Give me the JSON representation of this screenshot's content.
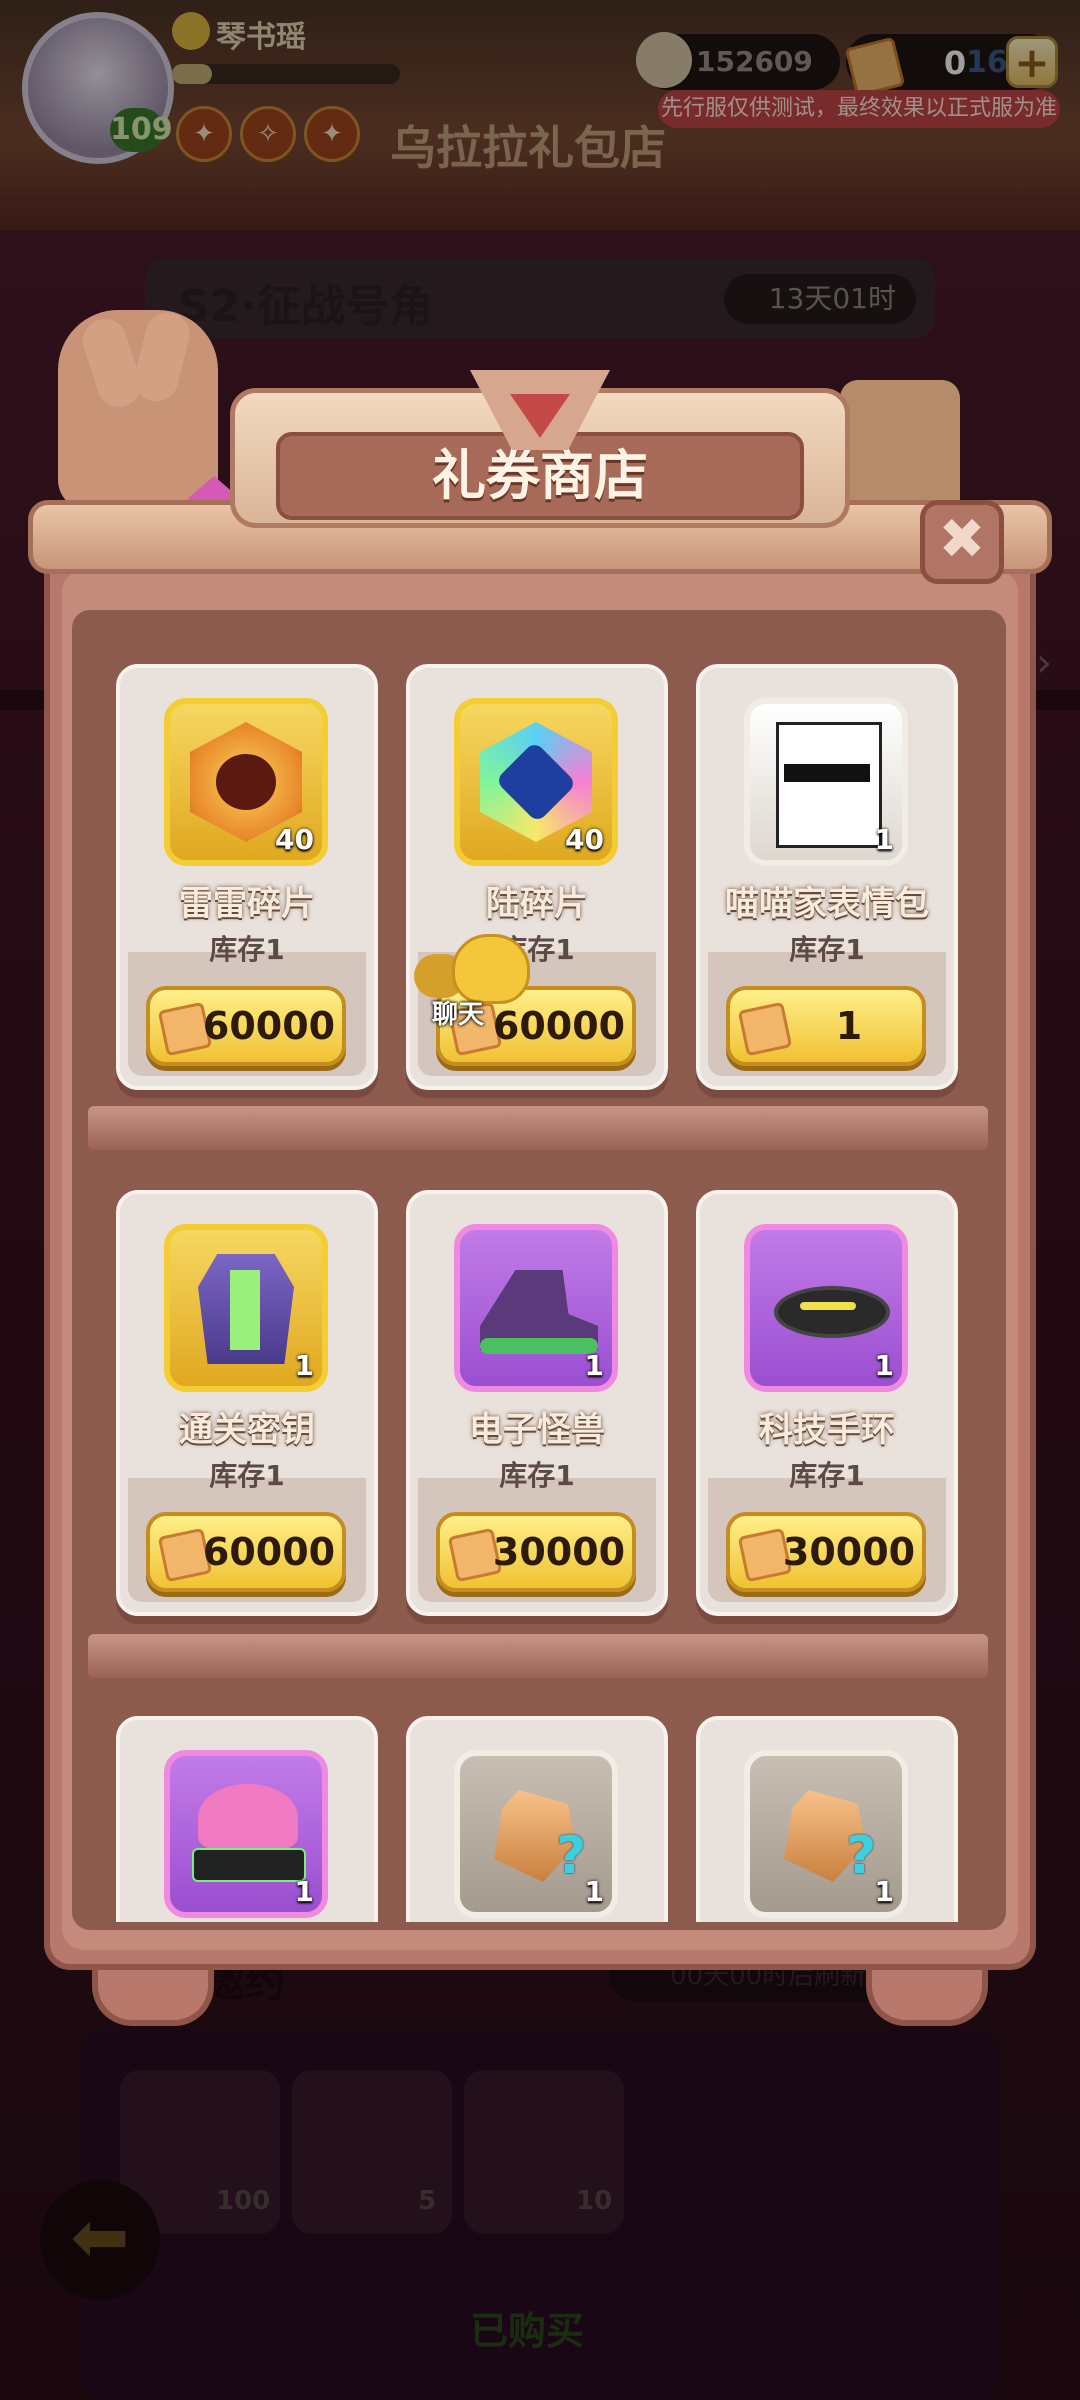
{
  "player": {
    "name": "琴书瑶",
    "level": "109"
  },
  "currency": {
    "coins": "152609",
    "tickets": "0",
    "tickets_under": "16",
    "add_label": "+"
  },
  "notice": "先行服仅供测试，最终效果以正式服为准",
  "background": {
    "shop_name": "乌拉拉礼包店",
    "season_title": "S2·征战号角",
    "season_timer": "13天01时",
    "section_title": "的邀约",
    "section_timer": "00天00时后刷新",
    "rewards": [
      "100",
      "5",
      "10"
    ],
    "bought_label": "已购买"
  },
  "popup": {
    "title": "礼券商店",
    "close_label": "✖",
    "items": [
      {
        "name": "雷雷碎片",
        "qty": "40",
        "stock": "库存1",
        "price": "60000",
        "icon": "thunder-shard-icon"
      },
      {
        "name": "陆碎片",
        "qty": "40",
        "stock": "库存1",
        "price": "60000",
        "icon": "lu-shard-icon"
      },
      {
        "name": "喵喵家表情包",
        "qty": "1",
        "stock": "库存1",
        "price": "1",
        "icon": "cat-sticker-icon"
      },
      {
        "name": "通关密钥",
        "qty": "1",
        "stock": "库存1",
        "price": "60000",
        "icon": "jacket-icon"
      },
      {
        "name": "电子怪兽",
        "qty": "1",
        "stock": "库存1",
        "price": "30000",
        "icon": "shoe-icon"
      },
      {
        "name": "科技手环",
        "qty": "1",
        "stock": "库存1",
        "price": "30000",
        "icon": "tech-bracelet-icon"
      },
      {
        "name": "",
        "qty": "1",
        "stock": "",
        "price": "",
        "icon": "hair-visor-icon"
      },
      {
        "name": "",
        "qty": "1",
        "stock": "",
        "price": "",
        "icon": "mystery-stone-icon"
      },
      {
        "name": "",
        "qty": "1",
        "stock": "",
        "price": "",
        "icon": "mystery-stone-icon"
      }
    ]
  },
  "chat": {
    "label": "聊天"
  },
  "colors": {
    "accent_gold": "#f0c232",
    "wood": "#b8786c",
    "notice_red": "#c44444"
  }
}
